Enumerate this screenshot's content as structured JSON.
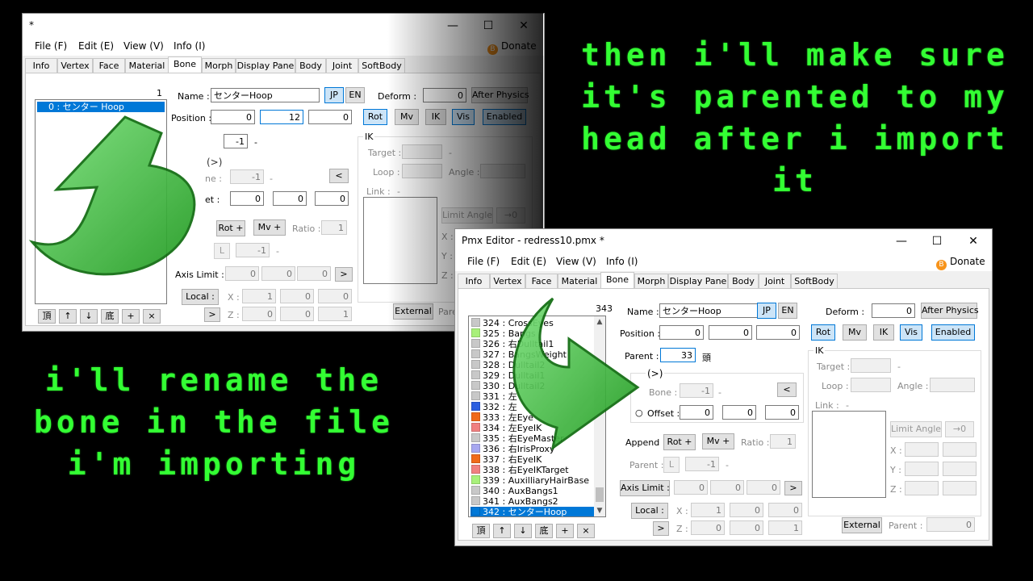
{
  "captions": {
    "top_right": "then i'll make sure it's parented to my head after i import it",
    "bottom_left": "i'll rename the bone in the file i'm importing"
  },
  "colors": {
    "caption": "#33ff33",
    "accent": "#0078d7",
    "arrow": "#3cc23c"
  },
  "win1": {
    "title": "*",
    "menu": [
      "File (F)",
      "Edit (E)",
      "View (V)",
      "Info (I)"
    ],
    "donate": "Donate",
    "tabs": [
      "Info",
      "Vertex",
      "Face",
      "Material",
      "Bone",
      "Morph",
      "Display Pane",
      "Body",
      "Joint",
      "SoftBody"
    ],
    "active_tab": "Bone",
    "count": "1",
    "list": [
      "0 : センター Hoop"
    ],
    "name_label": "Name :",
    "name_value": "センターHoop",
    "jp": "JP",
    "en": "EN",
    "deform_label": "Deform :",
    "deform_value": "0",
    "after_physics": "After Physics",
    "position_label": "Position :",
    "pos": [
      "0",
      "12",
      "0"
    ],
    "rot": "Rot",
    "mv": "Mv",
    "ik": "IK",
    "vis": "Vis",
    "enabled": "Enabled",
    "parent_value": "-1",
    "parent_dash": "-",
    "ik_group": "IK",
    "target_label": "Target :",
    "loop_label": "Loop :",
    "angle_label": "Angle :",
    "link_label": "Link :",
    "dash": "-",
    "chevron": "(>)",
    "tail_bone_label": "ne :",
    "tail_bone_value": "-1",
    "back": "<",
    "offset_label": "et :",
    "offset": [
      "0",
      "0",
      "0"
    ],
    "rot_plus": "Rot +",
    "mv_plus": "Mv +",
    "ratio_label": "Ratio :",
    "ratio_value": "1",
    "append_parent_btn": "L",
    "append_parent_value": "-1",
    "limit_angle": "Limit Angle",
    "to_zero": "→0",
    "xyz": [
      "X :",
      "Y :",
      "Z :"
    ],
    "axis_limit": "Axis Limit :",
    "axis_values": [
      "0",
      "0",
      "0"
    ],
    "fwd": ">",
    "local": "Local :",
    "local_x": [
      "1",
      "0",
      "0"
    ],
    "local_z": [
      "0",
      "0",
      "1"
    ],
    "external": "External",
    "ext_parent": "Pare",
    "bottom_btns": [
      "頂",
      "↑",
      "↓",
      "底",
      "+",
      "×"
    ]
  },
  "win2": {
    "title": "Pmx Editor - redress10.pmx *",
    "menu": [
      "File (F)",
      "Edit (E)",
      "View (V)",
      "Info (I)"
    ],
    "donate": "Donate",
    "tabs": [
      "Info",
      "Vertex",
      "Face",
      "Material",
      "Bone",
      "Morph",
      "Display Pane",
      "Body",
      "Joint",
      "SoftBody"
    ],
    "active_tab": "Bone",
    "count": "343",
    "list": [
      {
        "text": "324 : CrossEyes",
        "color": "#c8c8c8"
      },
      {
        "text": "325 : Bangs",
        "color": "#a8f07a"
      },
      {
        "text": "326 : 右Dulltail1",
        "color": "#c8c8c8"
      },
      {
        "text": "327 : BangsWeight",
        "color": "#c8c8c8"
      },
      {
        "text": "328 : Dulltail2",
        "color": "#c8c8c8"
      },
      {
        "text": "329 : Dulltail1",
        "color": "#c8c8c8"
      },
      {
        "text": "330 : Dulltail2",
        "color": "#c8c8c8"
      },
      {
        "text": "331 : 左",
        "color": "#c8c8c8"
      },
      {
        "text": "332 : 左",
        "color": "#2c5fe0"
      },
      {
        "text": "333 : 左Eye",
        "color": "#f06a1a"
      },
      {
        "text": "334 : 左EyeIK",
        "color": "#f08080"
      },
      {
        "text": "335 : 右EyeMaster",
        "color": "#c8c8c8"
      },
      {
        "text": "336 : 右IrisProxy",
        "color": "#a8a8f0"
      },
      {
        "text": "337 : 右EyeIK",
        "color": "#f06a1a"
      },
      {
        "text": "338 : 右EyeIKTarget",
        "color": "#f08080"
      },
      {
        "text": "339 : AuxilliaryHairBase",
        "color": "#a8f07a"
      },
      {
        "text": "340 : AuxBangs1",
        "color": "#c8c8c8"
      },
      {
        "text": "341 : AuxBangs2",
        "color": "#c8c8c8"
      },
      {
        "text": "342 : センターHoop",
        "color": "#0078d7"
      }
    ],
    "name_label": "Name :",
    "name_value": "センターHoop",
    "jp": "JP",
    "en": "EN",
    "deform_label": "Deform :",
    "deform_value": "0",
    "after_physics": "After Physics",
    "position_label": "Position :",
    "pos": [
      "0",
      "0",
      "0"
    ],
    "rot": "Rot",
    "mv": "Mv",
    "ik": "IK",
    "vis": "Vis",
    "enabled": "Enabled",
    "parent_label": "Parent :",
    "parent_value": "33",
    "parent_name": "頭",
    "ik_group": "IK",
    "target_label": "Target :",
    "loop_label": "Loop :",
    "angle_label": "Angle :",
    "link_label": "Link :",
    "dash": "-",
    "chevron": "(>)",
    "tail_bone_label": "Bone :",
    "tail_bone_value": "-1",
    "back": "<",
    "offset_label": "Offset :",
    "offset": [
      "0",
      "0",
      "0"
    ],
    "append_label": "Append :",
    "rot_plus": "Rot +",
    "mv_plus": "Mv +",
    "ratio_label": "Ratio :",
    "ratio_value": "1",
    "append_parent_label": "Parent :",
    "append_parent_btn": "L",
    "append_parent_value": "-1",
    "limit_angle": "Limit Angle",
    "to_zero": "→0",
    "xyz": [
      "X :",
      "Y :",
      "Z :"
    ],
    "axis_limit": "Axis Limit :",
    "axis_values": [
      "0",
      "0",
      "0"
    ],
    "fwd": ">",
    "local": "Local :",
    "local_x": [
      "1",
      "0",
      "0"
    ],
    "local_z": [
      "0",
      "0",
      "1"
    ],
    "external": "External",
    "ext_parent_label": "Parent :",
    "ext_parent_value": "0",
    "bottom_btns": [
      "頂",
      "↑",
      "↓",
      "底",
      "+",
      "×"
    ]
  }
}
